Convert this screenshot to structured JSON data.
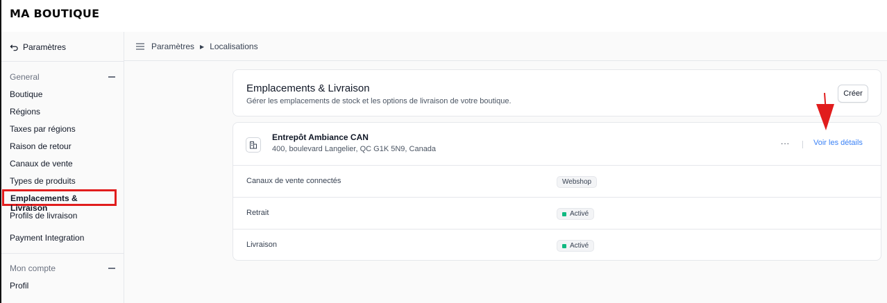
{
  "brand": "MA BOUTIQUE",
  "sidebar": {
    "back_label": "Paramètres",
    "general_group": "General",
    "general_items": [
      {
        "label": "Boutique"
      },
      {
        "label": "Régions"
      },
      {
        "label": "Taxes par régions"
      },
      {
        "label": "Raison de retour"
      },
      {
        "label": "Canaux de vente"
      },
      {
        "label": "Types de produits"
      },
      {
        "label": "Emplacements & Livraison",
        "active": true
      },
      {
        "label": "Profils de livraison"
      },
      {
        "label": "Payment Integration"
      }
    ],
    "account_group": "Mon compte",
    "account_items": [
      {
        "label": "Profil"
      }
    ]
  },
  "breadcrumb": {
    "parent": "Paramètres",
    "current": "Localisations"
  },
  "header_card": {
    "title": "Emplacements & Livraison",
    "subtitle": "Gérer les emplacements de stock et les options de livraison de votre boutique.",
    "create_label": "Créer"
  },
  "location": {
    "name": "Entrepôt Ambiance CAN",
    "address": "400, boulevard Langelier, QC G1K 5N9, Canada",
    "more_label": "...",
    "details_label": "Voir les détails",
    "rows": [
      {
        "label": "Canaux de vente connectés",
        "value": "Webshop",
        "status_dot": false
      },
      {
        "label": "Retrait",
        "value": "Activé",
        "status_dot": true
      },
      {
        "label": "Livraison",
        "value": "Activé",
        "status_dot": true
      }
    ]
  },
  "colors": {
    "accent_link": "#3b82f6",
    "active_dot": "#10b981",
    "highlight": "#e11d1d"
  }
}
